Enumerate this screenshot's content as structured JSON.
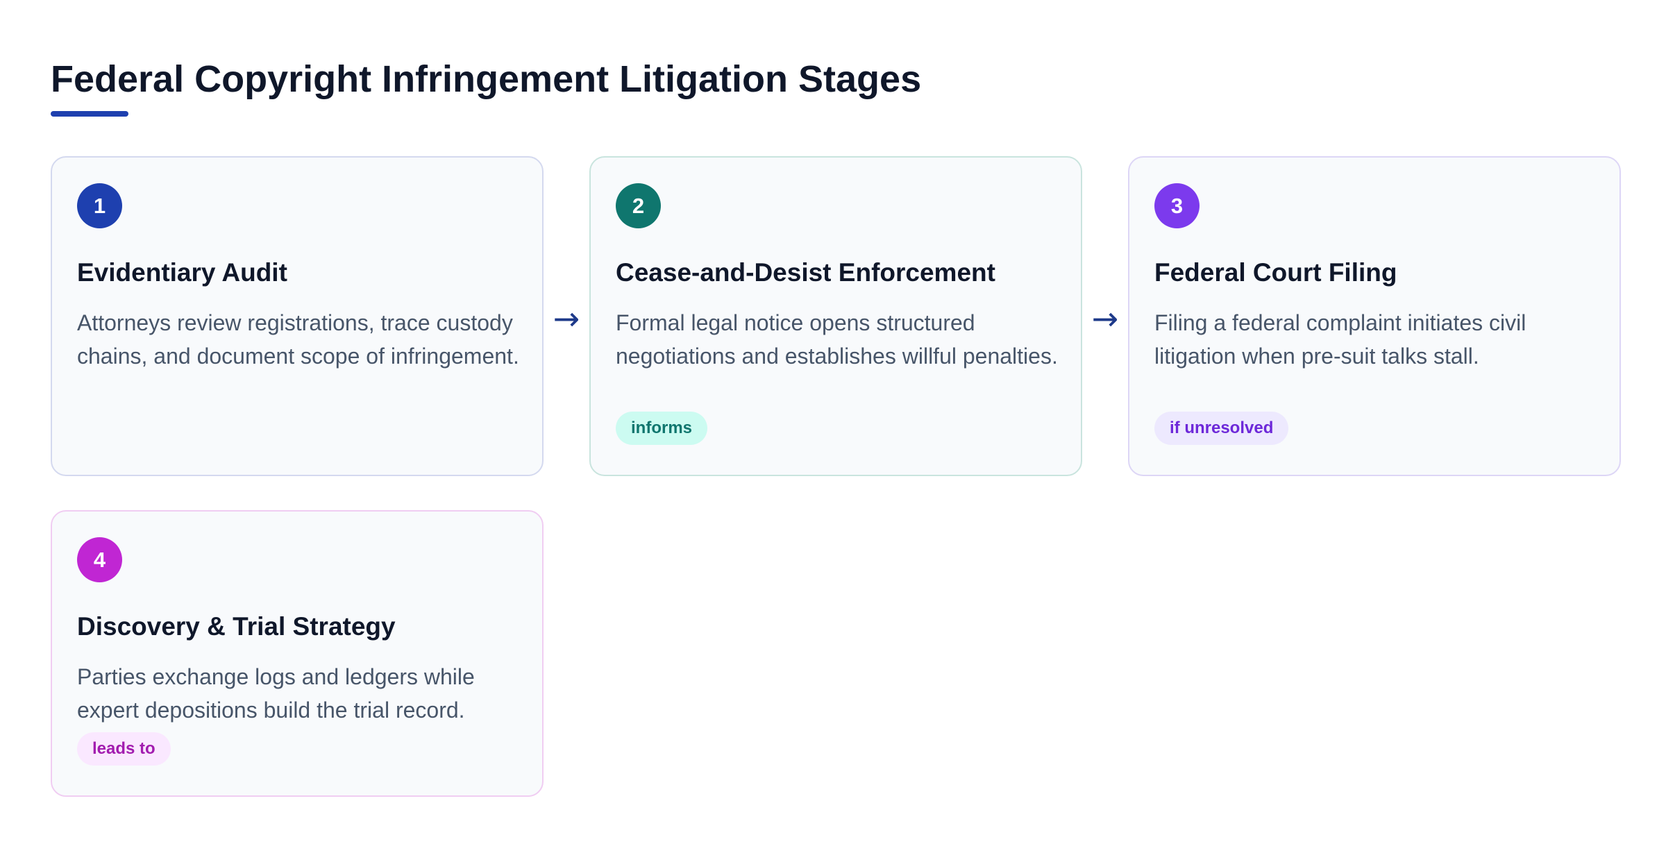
{
  "page": {
    "title": "Federal Copyright Infringement Litigation Stages"
  },
  "stages": [
    {
      "number": "1",
      "title": "Evidentiary Audit",
      "description": "Attorneys review registrations, trace custody chains, and document scope of infringement.",
      "badge": "",
      "color": "#1e40af"
    },
    {
      "number": "2",
      "title": "Cease-and-Desist Enforcement",
      "description": "Formal legal notice opens structured negotiations and establishes willful penalties.",
      "badge": "informs",
      "color": "#0f766e"
    },
    {
      "number": "3",
      "title": "Federal Court Filing",
      "description": "Filing a federal complaint initiates civil litigation when pre-suit talks stall.",
      "badge": "if unresolved",
      "color": "#7c3aed"
    },
    {
      "number": "4",
      "title": "Discovery & Trial Strategy",
      "description": "Parties exchange logs and ledgers while expert depositions build the trial record.",
      "badge": "leads to",
      "color": "#c026d3"
    }
  ],
  "connectors": {
    "arrow_symbol": "→"
  }
}
